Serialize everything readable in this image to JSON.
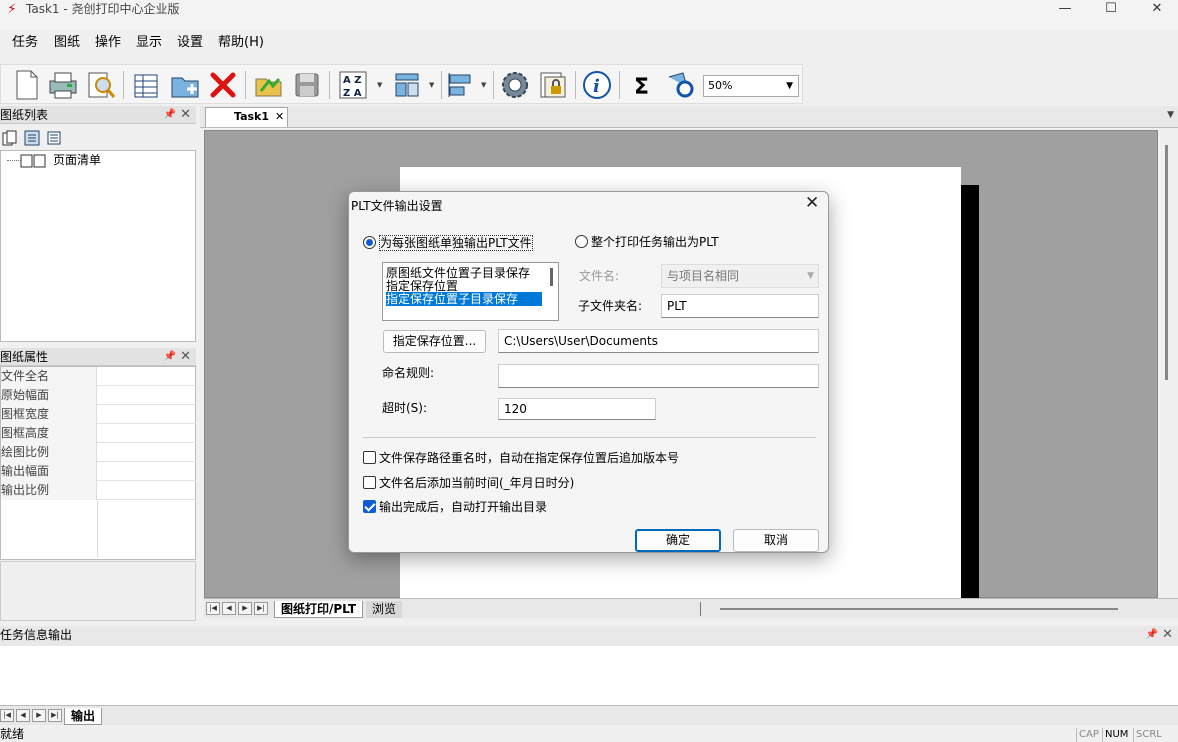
{
  "window": {
    "title": "Task1 - 尧创打印中心企业版",
    "minimize": "—",
    "maximize": "☐",
    "close": "✕"
  },
  "menu": [
    "任务",
    "图纸",
    "操作",
    "显示",
    "设置",
    "帮助(H)"
  ],
  "toolbar": {
    "zoom_value": "50%"
  },
  "left_panels": {
    "list_title": "图纸列表",
    "tree_item": "页面清单",
    "props_title": "图纸属性",
    "props": [
      "文件全名",
      "原始幅面",
      "图框宽度",
      "图框高度",
      "绘图比例",
      "输出幅面",
      "输出比例"
    ]
  },
  "doc": {
    "tab": "Task1",
    "bottom_tabs": [
      "图纸打印/PLT",
      "浏览"
    ]
  },
  "output": {
    "title": "任务信息输出",
    "tab": "输出"
  },
  "status": {
    "text": "就绪",
    "indicators": [
      "CAP",
      "NUM",
      "SCRL"
    ]
  },
  "dialog": {
    "title": "PLT文件输出设置",
    "radio_each": "为每张图纸单独输出PLT文件",
    "radio_whole": "整个打印任务输出为PLT",
    "list_items": [
      "原图纸文件位置子目录保存",
      "指定保存位置",
      "指定保存位置子目录保存"
    ],
    "filename_label": "文件名:",
    "filename_value": "与项目名相同",
    "subfolder_label": "子文件夹名:",
    "subfolder_value": "PLT",
    "save_location_button": "指定保存位置...",
    "save_path": "C:\\Users\\User\\Documents",
    "naming_label": "命名规则:",
    "naming_value": "",
    "timeout_label": "超时(S):",
    "timeout_value": "120",
    "check_version": "文件保存路径重名时，自动在指定保存位置后追加版本号",
    "check_time": "文件名后添加当前时间(_年月日时分)",
    "check_open": "输出完成后，自动打开输出目录",
    "ok": "确定",
    "cancel": "取消"
  }
}
